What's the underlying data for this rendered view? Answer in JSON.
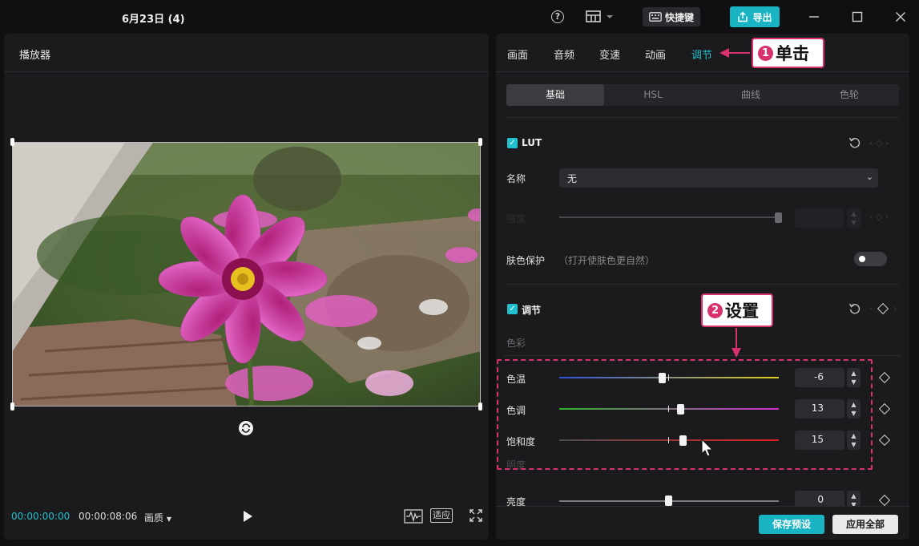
{
  "titlebar": {
    "title": "6月23日 (4)",
    "help_icon": "?",
    "shortcut_label": "快捷键",
    "export_label": "导出"
  },
  "player": {
    "title": "播放器",
    "time_current": "00:00:00:00",
    "time_total": "00:00:08:06",
    "quality_label": "画质",
    "fit_label": "适应"
  },
  "right": {
    "tabs": [
      {
        "label": "画面"
      },
      {
        "label": "音频"
      },
      {
        "label": "变速"
      },
      {
        "label": "动画"
      },
      {
        "label": "调节",
        "active": true
      }
    ],
    "subtabs": [
      {
        "label": "基础",
        "active": true
      },
      {
        "label": "HSL"
      },
      {
        "label": "曲线"
      },
      {
        "label": "色轮"
      }
    ],
    "lut": {
      "title": "LUT",
      "name_label": "名称",
      "name_value": "无",
      "intensity_label": "强度"
    },
    "skin": {
      "label": "肤色保护",
      "hint": "（打开使肤色更自然）",
      "enabled": false
    },
    "adjust": {
      "title": "调节",
      "color_group": "色彩",
      "light_group": "明度",
      "sliders": [
        {
          "key": "temp",
          "label": "色温",
          "value": "-6",
          "min": -50,
          "max": 50
        },
        {
          "key": "tint",
          "label": "色调",
          "value": "13",
          "min": -50,
          "max": 50
        },
        {
          "key": "sat",
          "label": "饱和度",
          "value": "15",
          "min": -50,
          "max": 50
        },
        {
          "key": "bright",
          "label": "亮度",
          "value": "0",
          "min": -50,
          "max": 50
        }
      ]
    },
    "footer": {
      "save_label": "保存预设",
      "apply_label": "应用全部"
    }
  },
  "annotations": {
    "step1_num": "1",
    "step1_label": "单击",
    "step2_num": "2",
    "step2_label": "设置"
  },
  "colors": {
    "accent": "#18b4c3",
    "annotation": "#d9316d",
    "panel": "#1b1b1d"
  }
}
